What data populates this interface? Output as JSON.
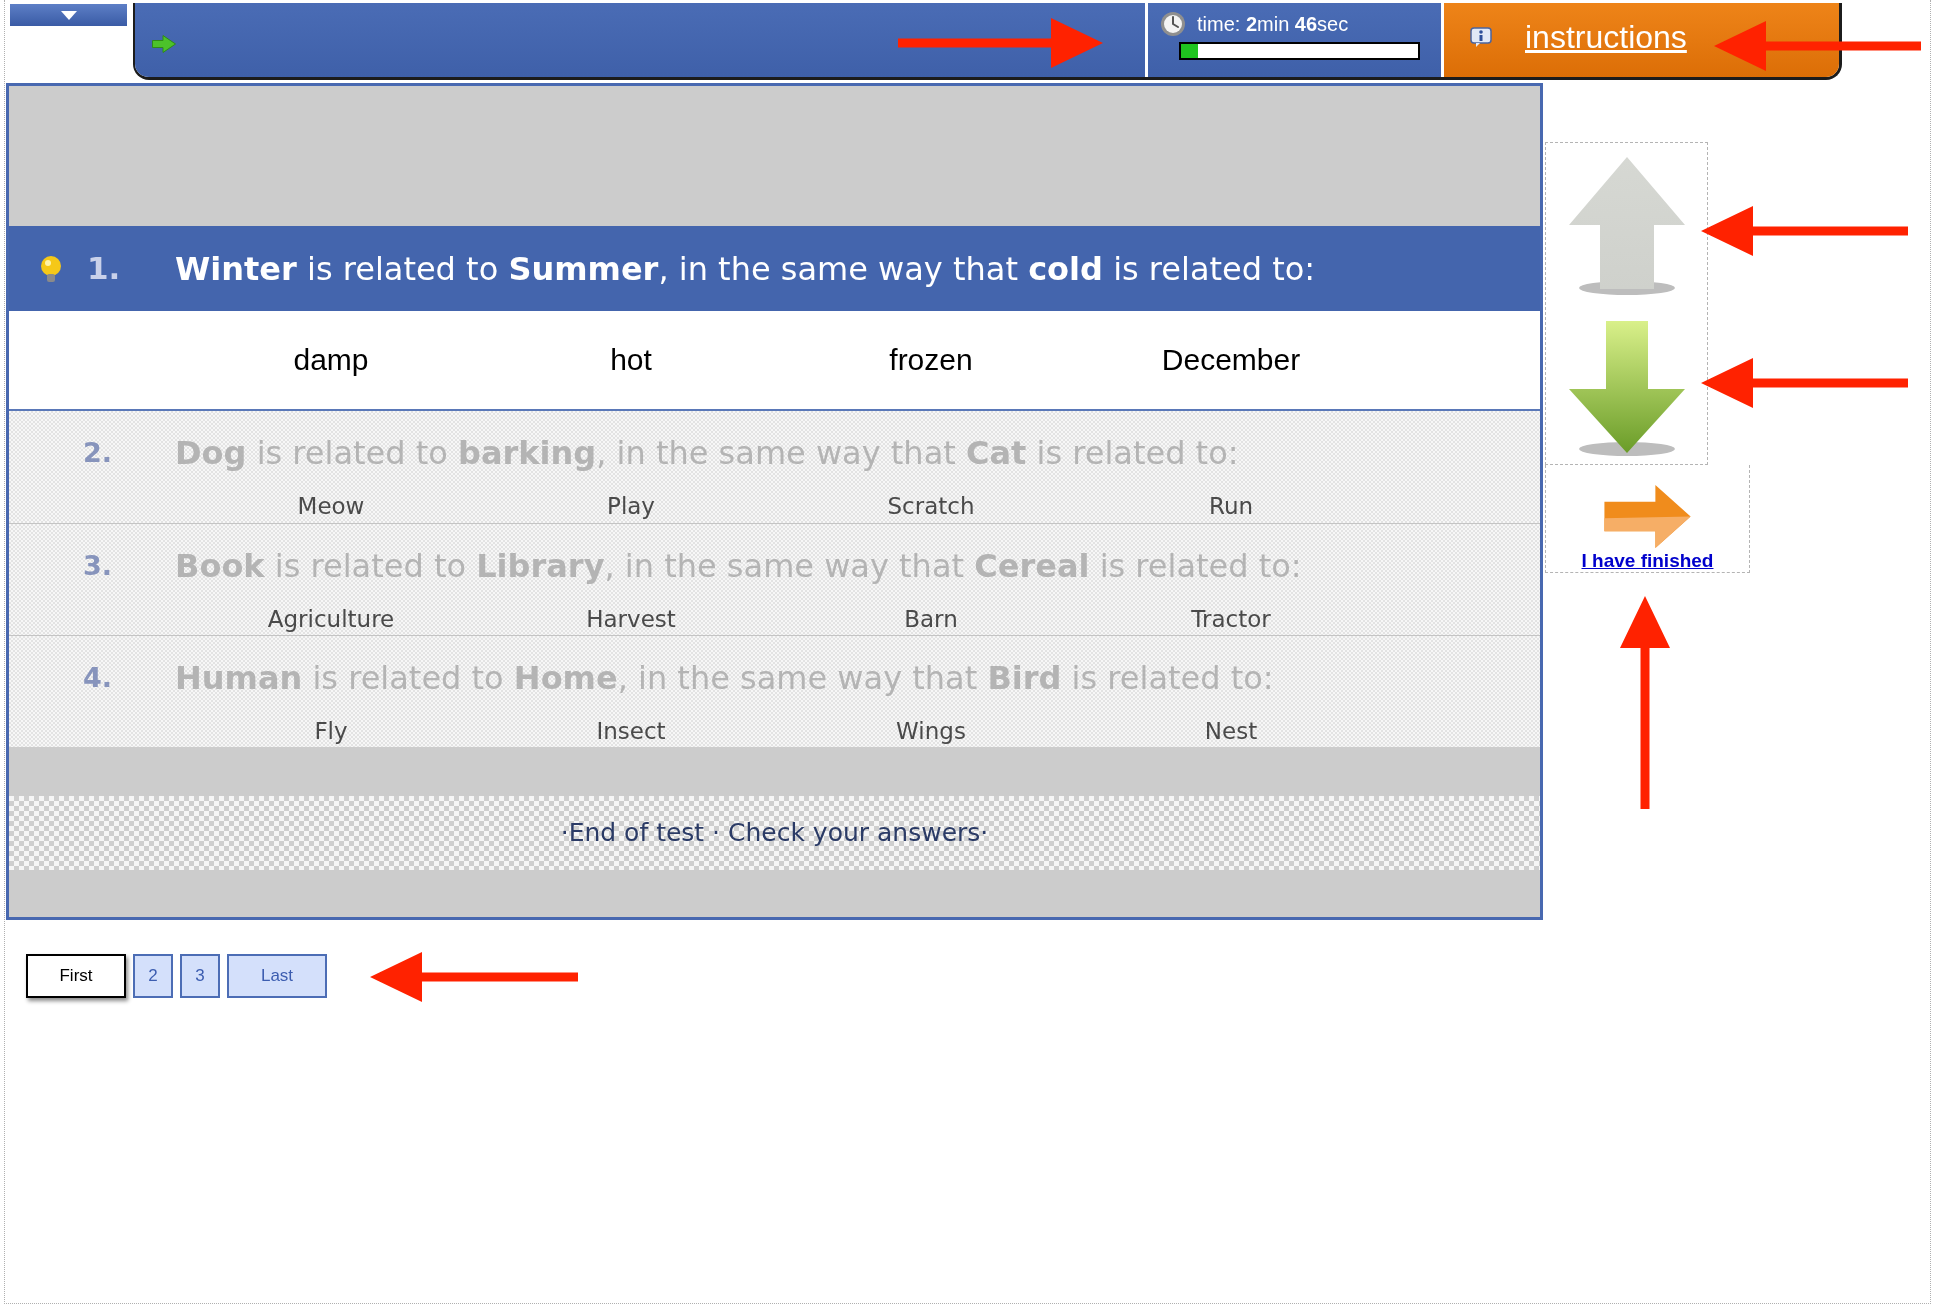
{
  "timer": {
    "label": "time: **2**min **46**sec",
    "level": 0.07
  },
  "instructions_link": "instructions",
  "questions": [
    {
      "number": "1.",
      "text": "**Winter** is related to **Summer**, in the same way that **cold** is related to:",
      "selected": true,
      "options": [
        "damp",
        "hot",
        "frozen",
        "December"
      ]
    },
    {
      "number": "2.",
      "text": "**Dog** is related to **barking**, in the same way that **Cat** is related to:",
      "selected": false,
      "options": [
        "Meow",
        "Play",
        "Scratch",
        "Run"
      ]
    },
    {
      "number": "3.",
      "text": "**Book** is related to **Library**, in the same way that **Cereal** is related to:",
      "selected": false,
      "options": [
        "Agriculture",
        "Harvest",
        "Barn",
        "Tractor"
      ]
    },
    {
      "number": "4.",
      "text": "**Human** is related to **Home**, in the same way that **Bird** is related to:",
      "selected": false,
      "options": [
        "Fly",
        "Insect",
        "Wings",
        "Nest"
      ]
    }
  ],
  "end_of_test": "·End of test · Check your answers·",
  "nav_buttons": [
    {
      "kind": "up",
      "disabled": true
    },
    {
      "kind": "down",
      "disabled": false
    }
  ],
  "finish_link": "I have finished",
  "pagination": [
    {
      "label": "First",
      "selected": true
    },
    {
      "label": "2",
      "selected": false
    },
    {
      "label": "3",
      "selected": false
    },
    {
      "label": "Last",
      "selected": false
    }
  ]
}
